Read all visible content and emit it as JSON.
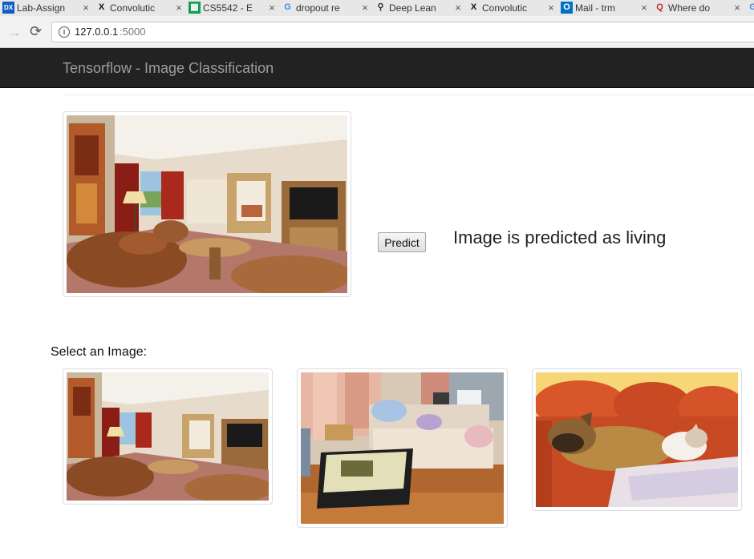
{
  "browser": {
    "tabs": [
      {
        "favicon": "dropbox-icon",
        "fav_glyph": "DX",
        "fav_bg": "#0f5fc4",
        "fav_color": "#ffffff",
        "title": "Lab-Assign"
      },
      {
        "favicon": "x-icon",
        "fav_glyph": "X",
        "fav_bg": "#e7e7e7",
        "fav_color": "#111111",
        "title": "Convolutic"
      },
      {
        "favicon": "sheets-icon",
        "fav_glyph": "▦",
        "fav_bg": "#0f9d58",
        "fav_color": "#ffffff",
        "title": "CS5542 - E"
      },
      {
        "favicon": "google-icon",
        "fav_glyph": "G",
        "fav_bg": "#e7e7e7",
        "fav_color": "#4285f4",
        "title": "dropout re"
      },
      {
        "favicon": "link-icon",
        "fav_glyph": "⚲",
        "fav_bg": "#e7e7e7",
        "fav_color": "#333333",
        "title": "Deep Lean"
      },
      {
        "favicon": "x-icon",
        "fav_glyph": "X",
        "fav_bg": "#e7e7e7",
        "fav_color": "#111111",
        "title": "Convolutic"
      },
      {
        "favicon": "outlook-icon",
        "fav_glyph": "O",
        "fav_bg": "#0072c6",
        "fav_color": "#ffffff",
        "title": "Mail - trm"
      },
      {
        "favicon": "quora-icon",
        "fav_glyph": "Q",
        "fav_bg": "#e7e7e7",
        "fav_color": "#b92b27",
        "title": "Where do"
      },
      {
        "favicon": "google-icon",
        "fav_glyph": "G",
        "fav_bg": "#e7e7e7",
        "fav_color": "#4285f4",
        "title": ""
      }
    ],
    "url_host": "127.0.0.1",
    "url_port": ":5000"
  },
  "navbar": {
    "brand": "Tensorflow - Image Classification"
  },
  "main": {
    "predict_label": "Predict",
    "prediction": "Image is predicted as living",
    "select_label": "Select an Image:"
  },
  "colors": {
    "navbar_bg": "#222222",
    "brand_text": "#9d9d9d"
  }
}
